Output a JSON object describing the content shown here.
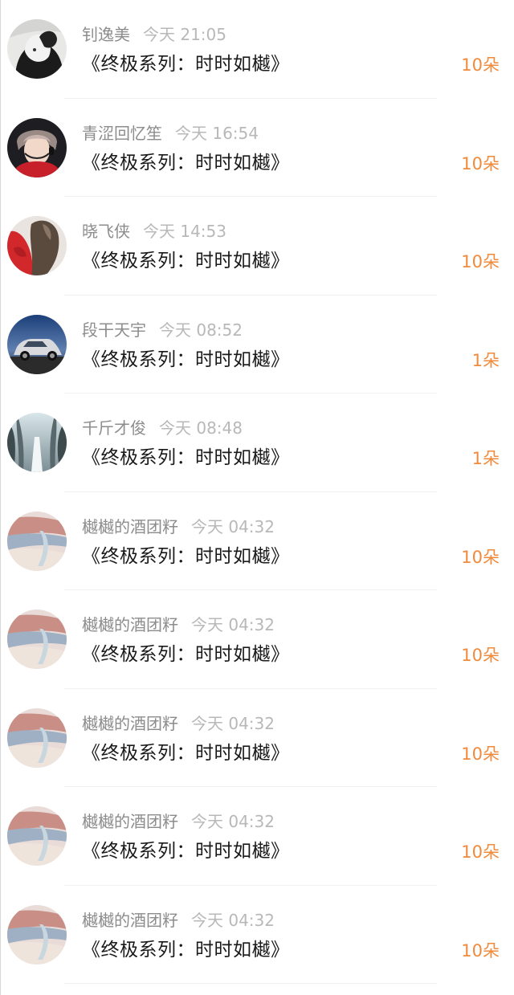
{
  "rows": [
    {
      "name": "钊逸美",
      "time": "今天 21:05",
      "title": "《终极系列：时时如樾》",
      "gift": "10朵",
      "avatar": "cat-avatar"
    },
    {
      "name": "青涩回忆笙",
      "time": "今天 16:54",
      "title": "《终极系列：时时如樾》",
      "gift": "10朵",
      "avatar": "idol-avatar"
    },
    {
      "name": "晓飞侠",
      "time": "今天 14:53",
      "title": "《终极系列：时时如樾》",
      "gift": "10朵",
      "avatar": "red-outfit-avatar"
    },
    {
      "name": "段干天宇",
      "time": "今天 08:52",
      "title": "《终极系列：时时如樾》",
      "gift": "1朵",
      "avatar": "car-avatar"
    },
    {
      "name": "千斤才俊",
      "time": "今天 08:48",
      "title": "《终极系列：时时如樾》",
      "gift": "1朵",
      "avatar": "snow-forest-avatar"
    },
    {
      "name": "樾樾的酒团籽",
      "time": "今天 04:32",
      "title": "《终极系列：时时如樾》",
      "gift": "10朵",
      "avatar": "sunset-sky-avatar"
    },
    {
      "name": "樾樾的酒团籽",
      "time": "今天 04:32",
      "title": "《终极系列：时时如樾》",
      "gift": "10朵",
      "avatar": "sunset-sky-avatar"
    },
    {
      "name": "樾樾的酒团籽",
      "time": "今天 04:32",
      "title": "《终极系列：时时如樾》",
      "gift": "10朵",
      "avatar": "sunset-sky-avatar"
    },
    {
      "name": "樾樾的酒团籽",
      "time": "今天 04:32",
      "title": "《终极系列：时时如樾》",
      "gift": "10朵",
      "avatar": "sunset-sky-avatar"
    },
    {
      "name": "樾樾的酒团籽",
      "time": "今天 04:32",
      "title": "《终极系列：时时如樾》",
      "gift": "10朵",
      "avatar": "sunset-sky-avatar"
    }
  ],
  "colors": {
    "accent": "#f08a3c",
    "name": "#8c8c8c",
    "time": "#b8b8b8",
    "title": "#1a1a1a"
  }
}
